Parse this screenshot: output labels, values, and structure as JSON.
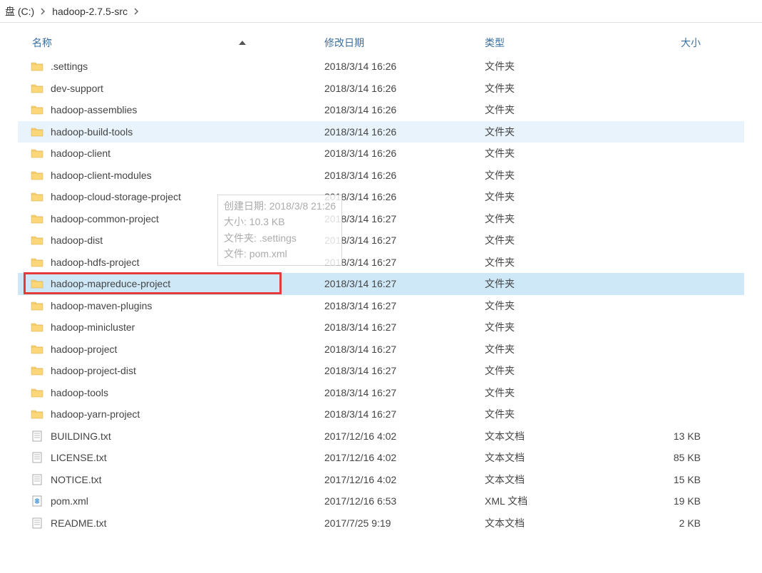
{
  "breadcrumb": {
    "p1": "盘 (C:)",
    "p2": "hadoop-2.7.5-src"
  },
  "headers": {
    "name": "名称",
    "date": "修改日期",
    "type": "类型",
    "size": "大小"
  },
  "tooltip": {
    "l1": "创建日期: 2018/3/8 21:26",
    "l2": "大小: 10.3 KB",
    "l3": "文件夹: .settings",
    "l4": "文件: pom.xml"
  },
  "rows": [
    {
      "icon": "folder",
      "name": ".settings",
      "date": "2018/3/14 16:26",
      "type": "文件夹",
      "size": "",
      "state": ""
    },
    {
      "icon": "folder",
      "name": "dev-support",
      "date": "2018/3/14 16:26",
      "type": "文件夹",
      "size": "",
      "state": ""
    },
    {
      "icon": "folder",
      "name": "hadoop-assemblies",
      "date": "2018/3/14 16:26",
      "type": "文件夹",
      "size": "",
      "state": ""
    },
    {
      "icon": "folder",
      "name": "hadoop-build-tools",
      "date": "2018/3/14 16:26",
      "type": "文件夹",
      "size": "",
      "state": "hover"
    },
    {
      "icon": "folder",
      "name": "hadoop-client",
      "date": "2018/3/14 16:26",
      "type": "文件夹",
      "size": "",
      "state": ""
    },
    {
      "icon": "folder",
      "name": "hadoop-client-modules",
      "date": "2018/3/14 16:26",
      "type": "文件夹",
      "size": "",
      "state": ""
    },
    {
      "icon": "folder",
      "name": "hadoop-cloud-storage-project",
      "date": "2018/3/14 16:26",
      "type": "文件夹",
      "size": "",
      "state": ""
    },
    {
      "icon": "folder",
      "name": "hadoop-common-project",
      "date": "2018/3/14 16:27",
      "type": "文件夹",
      "size": "",
      "state": ""
    },
    {
      "icon": "folder",
      "name": "hadoop-dist",
      "date": "2018/3/14 16:27",
      "type": "文件夹",
      "size": "",
      "state": ""
    },
    {
      "icon": "folder",
      "name": "hadoop-hdfs-project",
      "date": "2018/3/14 16:27",
      "type": "文件夹",
      "size": "",
      "state": ""
    },
    {
      "icon": "folder",
      "name": "hadoop-mapreduce-project",
      "date": "2018/3/14 16:27",
      "type": "文件夹",
      "size": "",
      "state": "selected",
      "redbox": true
    },
    {
      "icon": "folder",
      "name": "hadoop-maven-plugins",
      "date": "2018/3/14 16:27",
      "type": "文件夹",
      "size": "",
      "state": ""
    },
    {
      "icon": "folder",
      "name": "hadoop-minicluster",
      "date": "2018/3/14 16:27",
      "type": "文件夹",
      "size": "",
      "state": ""
    },
    {
      "icon": "folder",
      "name": "hadoop-project",
      "date": "2018/3/14 16:27",
      "type": "文件夹",
      "size": "",
      "state": ""
    },
    {
      "icon": "folder",
      "name": "hadoop-project-dist",
      "date": "2018/3/14 16:27",
      "type": "文件夹",
      "size": "",
      "state": ""
    },
    {
      "icon": "folder",
      "name": "hadoop-tools",
      "date": "2018/3/14 16:27",
      "type": "文件夹",
      "size": "",
      "state": ""
    },
    {
      "icon": "folder",
      "name": "hadoop-yarn-project",
      "date": "2018/3/14 16:27",
      "type": "文件夹",
      "size": "",
      "state": ""
    },
    {
      "icon": "txt",
      "name": "BUILDING.txt",
      "date": "2017/12/16 4:02",
      "type": "文本文档",
      "size": "13 KB",
      "state": ""
    },
    {
      "icon": "txt",
      "name": "LICENSE.txt",
      "date": "2017/12/16 4:02",
      "type": "文本文档",
      "size": "85 KB",
      "state": ""
    },
    {
      "icon": "txt",
      "name": "NOTICE.txt",
      "date": "2017/12/16 4:02",
      "type": "文本文档",
      "size": "15 KB",
      "state": ""
    },
    {
      "icon": "xml",
      "name": "pom.xml",
      "date": "2017/12/16 6:53",
      "type": "XML 文档",
      "size": "19 KB",
      "state": ""
    },
    {
      "icon": "txt",
      "name": "README.txt",
      "date": "2017/7/25 9:19",
      "type": "文本文档",
      "size": "2 KB",
      "state": ""
    }
  ]
}
